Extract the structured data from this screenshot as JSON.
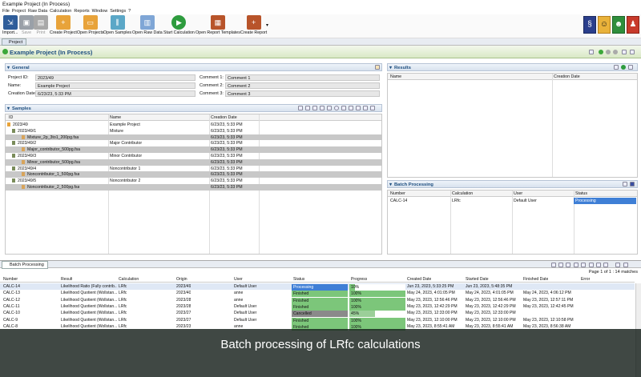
{
  "window": {
    "title": "Example Project (In Process)"
  },
  "menu": [
    "File",
    "Project",
    "Raw Data",
    "Calculation",
    "Reports",
    "Window",
    "Settings",
    "?"
  ],
  "toolbar": {
    "import": "Import...",
    "save": "Save",
    "print": "Print",
    "create_project": "Create Project",
    "open_projects": "Open Projects",
    "open_samples": "Open Samples",
    "open_raw_data": "Open Raw Data",
    "start_calculation": "Start Calculation",
    "open_report_templates": "Open Report Templates",
    "create_report": "Create Report"
  },
  "tab": {
    "label": "Project"
  },
  "project_header": {
    "title": "Example Project (In Process)"
  },
  "general": {
    "header": "General",
    "project_id_label": "Project ID:",
    "project_id": "2023/49",
    "name_label": "Name:",
    "name": "Example Project",
    "creation_date_label": "Creation Date:",
    "creation_date": "6/23/23, 5:33 PM",
    "comment1_label": "Comment 1:",
    "comment1": "Comment 1",
    "comment2_label": "Comment 2:",
    "comment2": "Comment 2",
    "comment3_label": "Comment 3:",
    "comment3": "Comment 3"
  },
  "samples": {
    "header": "Samples",
    "columns": [
      "ID",
      "Name",
      "Creation Date"
    ],
    "rows": [
      {
        "id": "2023/49",
        "name": "Example Project",
        "date": "6/23/23, 5:33 PM"
      },
      {
        "id": "2023/49/1",
        "name": "Mixture",
        "date": "6/23/23, 5:33 PM"
      },
      {
        "id": "Mixture_2p_3to1_200pg.fsa",
        "name": "",
        "date": "6/23/23, 5:33 PM"
      },
      {
        "id": "2023/49/2",
        "name": "Major Contributor",
        "date": "6/23/23, 5:33 PM"
      },
      {
        "id": "Major_contributor_500pg.fsa",
        "name": "",
        "date": "6/23/23, 5:33 PM"
      },
      {
        "id": "2023/49/3",
        "name": "Minor Contributor",
        "date": "6/23/23, 5:33 PM"
      },
      {
        "id": "Minor_contributor_500pg.fsa",
        "name": "",
        "date": "6/23/23, 5:33 PM"
      },
      {
        "id": "2023/49/4",
        "name": "Noncontributor 1",
        "date": "6/23/23, 5:33 PM"
      },
      {
        "id": "Noncontributor_1_500pg.fsa",
        "name": "",
        "date": "6/23/23, 5:33 PM"
      },
      {
        "id": "2023/49/5",
        "name": "Noncontributor 2",
        "date": "6/23/23, 5:33 PM"
      },
      {
        "id": "Noncontributor_2_500pg.fsa",
        "name": "",
        "date": "6/23/23, 5:33 PM"
      }
    ]
  },
  "results": {
    "header": "Results",
    "columns": [
      "Name",
      "Creation Date"
    ]
  },
  "batch_small": {
    "header": "Batch Processing",
    "columns": [
      "Number",
      "Calculation",
      "User",
      "Status"
    ],
    "row": {
      "number": "CALC-14",
      "calculation": "LRfc",
      "user": "Default User",
      "status": "Processing"
    }
  },
  "batch_view": {
    "tab": "Batch Processing",
    "pager": "Page 1 of 1 : 14 matches",
    "columns": [
      "Number",
      "Result",
      "Calculation",
      "Origin",
      "User",
      "Status",
      "Progress",
      "Created Date",
      "Started Date",
      "Finished Date",
      "Error"
    ],
    "rows": [
      {
        "number": "CALC-14",
        "result": "Likelihood Ratio (Fully contrib...",
        "calc": "LRfc",
        "origin": "2023/49",
        "user": "Default User",
        "status": "Processing",
        "progress": "10%",
        "progress_value": 0.1,
        "created": "Jun 23, 2023, 5:33:25 PM",
        "started": "Jun 23, 2023, 5:48:35 PM",
        "finished": ""
      },
      {
        "number": "CALC-13",
        "result": "Likelihood Quotient (Wollstan...",
        "calc": "LRfc",
        "origin": "2023/40",
        "user": "anne",
        "status": "Finished",
        "progress": "100%",
        "progress_value": 1.0,
        "created": "May 24, 2023, 4:01:05 PM",
        "started": "May 24, 2023, 4:01:05 PM",
        "finished": "May 24, 2023, 4:06:12 PM"
      },
      {
        "number": "CALC-12",
        "result": "Likelihood Quotient (Wollstan...",
        "calc": "LRfc",
        "origin": "2023/28",
        "user": "anne",
        "status": "Finished",
        "progress": "100%",
        "progress_value": 1.0,
        "created": "May 23, 2023, 12:56:46 PM",
        "started": "May 23, 2023, 12:56:46 PM",
        "finished": "May 23, 2023, 12:57:11 PM"
      },
      {
        "number": "CALC-11",
        "result": "Likelihood Quotient (Wollstan...",
        "calc": "LRfc",
        "origin": "2023/28",
        "user": "Default User",
        "status": "Finished",
        "progress": "100%",
        "progress_value": 1.0,
        "created": "May 23, 2023, 12:42:29 PM",
        "started": "May 23, 2023, 12:42:29 PM",
        "finished": "May 23, 2023, 12:42:45 PM"
      },
      {
        "number": "CALC-10",
        "result": "Likelihood Quotient (Wollstan...",
        "calc": "LRfc",
        "origin": "2023/27",
        "user": "Default User",
        "status": "Cancelled",
        "progress": "45%",
        "progress_value": 0.45,
        "created": "May 23, 2023, 12:33:00 PM",
        "started": "May 23, 2023, 12:33:00 PM",
        "finished": ""
      },
      {
        "number": "CALC-9",
        "result": "Likelihood Quotient (Wollstan...",
        "calc": "LRfc",
        "origin": "2023/27",
        "user": "Default User",
        "status": "Finished",
        "progress": "100%",
        "progress_value": 1.0,
        "created": "May 23, 2023, 12:10:00 PM",
        "started": "May 23, 2023, 12:10:00 PM",
        "finished": "May 23, 2023, 12:10:58 PM"
      },
      {
        "number": "CALC-8",
        "result": "Likelihood Quotient (Wollstan...",
        "calc": "LRfc",
        "origin": "2023/23",
        "user": "anne",
        "status": "Finished",
        "progress": "100%",
        "progress_value": 1.0,
        "created": "May 23, 2023, 8:55:41 AM",
        "started": "May 23, 2023, 8:55:41 AM",
        "finished": "May 23, 2023, 8:56:38 AM"
      }
    ]
  },
  "caption": "Batch processing of LRfc calculations",
  "colors": {
    "processing": "#3f7fd6",
    "finished": "#7cc67a",
    "cancelled": "#8a8a8a",
    "title": "#205080"
  }
}
